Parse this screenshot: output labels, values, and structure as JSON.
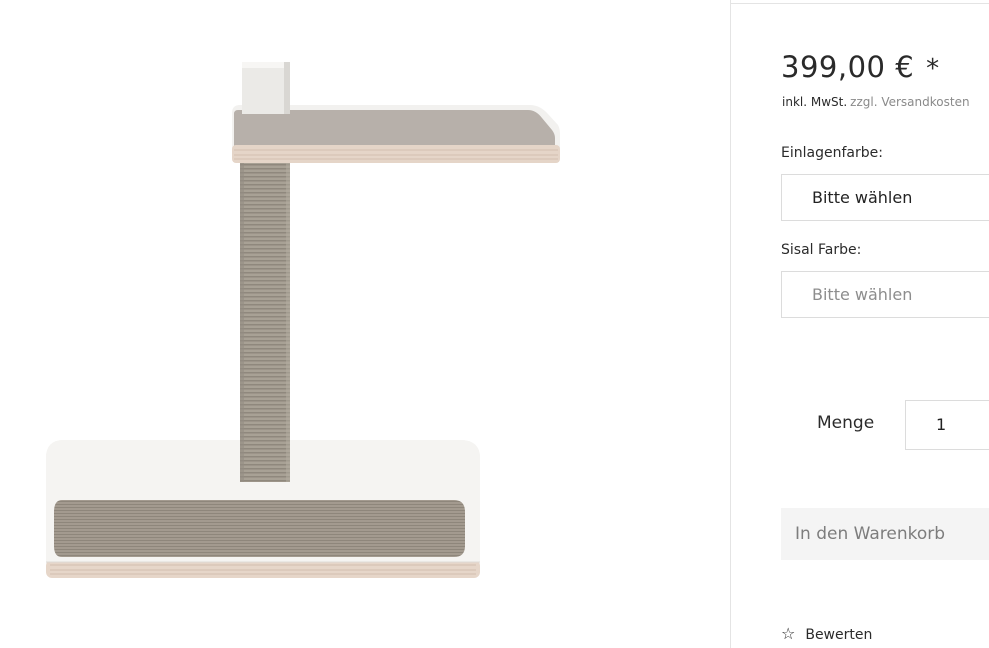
{
  "product": {
    "image_alt": "Kratzbaum mit Liegefläche"
  },
  "buy_box": {
    "price": "399,00 €",
    "price_asterisk": "*",
    "tax_label": "inkl. MwSt.",
    "shipping_label": "zzgl. Versandkosten",
    "insert_color_label": "Einlagenfarbe:",
    "insert_color_value": "Bitte wählen",
    "sisal_color_label": "Sisal Farbe:",
    "sisal_color_value": "Bitte wählen",
    "quantity_label": "Menge",
    "quantity_value": "1",
    "add_to_cart_label": "In den Warenkorb",
    "rate_label": "Bewerten"
  },
  "colors": {
    "felt": "#b8b1ab",
    "sisal": "#a39b90",
    "wood_edge": "#e3d3c6",
    "white_lacquer": "#f4f3f1"
  }
}
